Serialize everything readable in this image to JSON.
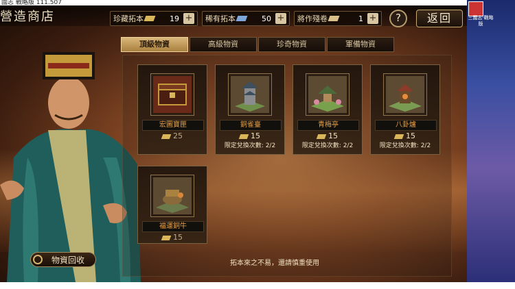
{
  "window": {
    "title": "國志 戰略版 111.507"
  },
  "desktop": {
    "shortcut_label": "三國志·戰略版"
  },
  "header": {
    "shop_title": "營造商店",
    "resources": [
      {
        "label": "珍藏拓本",
        "value": "19",
        "icon_color": "#d8b659"
      },
      {
        "label": "稀有拓本",
        "value": "50",
        "icon_color": "#7da7d9"
      },
      {
        "label": "將作殘卷",
        "value": "1",
        "icon_color": "#d9c08a"
      }
    ],
    "help_label": "?",
    "back_label": "返回"
  },
  "tabs": [
    {
      "label": "頂級物資",
      "active": true
    },
    {
      "label": "高級物資",
      "active": false
    },
    {
      "label": "珍奇物資",
      "active": false
    },
    {
      "label": "軍備物資",
      "active": false
    }
  ],
  "items": [
    {
      "name": "宏圖寶匣",
      "price": "25",
      "limit": ""
    },
    {
      "name": "銅雀臺",
      "price": "15",
      "limit": "限定兌換次數: 2/2"
    },
    {
      "name": "青梅亭",
      "price": "15",
      "limit": "限定兌換次數: 2/2"
    },
    {
      "name": "八卦爐",
      "price": "15",
      "limit": "限定兌換次數: 2/2"
    },
    {
      "name": "福運銅牛",
      "price": "15",
      "limit": ""
    }
  ],
  "footer": {
    "hint": "拓本來之不易，還請慎重使用",
    "recycle_label": "物資回收"
  }
}
